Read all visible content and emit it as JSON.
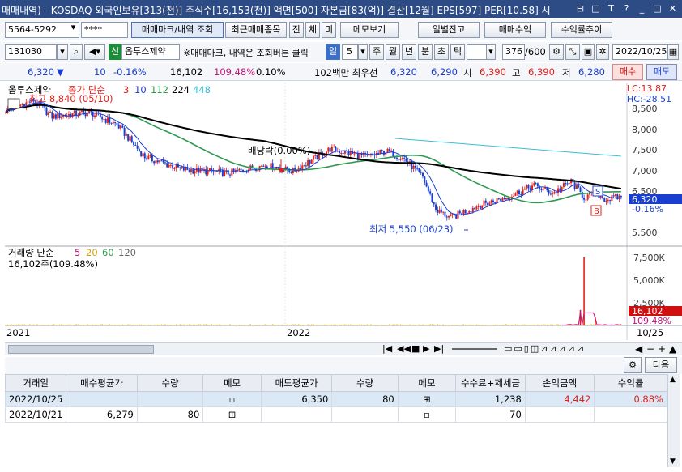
{
  "titlebar": {
    "text": "매매내역) - KOSDAQ 외국인보유[313(천)] 주식수[16,153(천)] 액면[500] 자본금[83(억)] 결산[12월] EPS[597] PER[10.58] 시"
  },
  "toolbar1": {
    "account": "5564-5292",
    "password": "****",
    "tab_trade": "매매마크/내역 조회",
    "tab_recent": "최근매매종목",
    "btn_jan": "잔",
    "btn_che": "체",
    "btn_mi": "미",
    "memo_view": "메모보기",
    "daily_balance": "일별잔고",
    "trade_profit": "매매수익",
    "return_trend": "수익률추이"
  },
  "toolbar2": {
    "code": "131030",
    "sin": "신",
    "stock_name": "옵투스제약",
    "notice": "※매매마크, 내역은 조회버튼 클릭",
    "period_active": "일",
    "period_value": "5",
    "periods": [
      "주",
      "월",
      "년",
      "분",
      "초",
      "틱"
    ],
    "count": "376",
    "count_total": "/600",
    "date": "2022/10/25"
  },
  "quote": {
    "price": "6,320",
    "arrow": "▼",
    "change": "10",
    "change_pct": "-0.16%",
    "volume": "16,102",
    "vol_ratio": "109.48%",
    "rate": "0.10%",
    "preferred": "102백만 최우선",
    "bid": "6,320",
    "ask": "6,290",
    "open_label": "시",
    "open": "6,390",
    "high_label": "고",
    "high": "6,390",
    "low_label": "저",
    "low": "6,280",
    "buy": "매수",
    "sell": "매도"
  },
  "chart": {
    "legend_name": "옵투스제약",
    "legend_ma": "종가 단순",
    "ma_values": [
      "3",
      "10",
      "112",
      "224",
      "448"
    ],
    "high_label": "최고 8,840 (05/10)",
    "low_label": "최저 5,550 (06/23)",
    "dividend_label": "배당락(0.00%)",
    "lc": "LC:13.87",
    "hc": "HC:-28.51",
    "price_axis": [
      "8,500",
      "8,000",
      "7,500",
      "7,000",
      "6,500",
      "5,500"
    ],
    "current_tag": "6,320",
    "current_pct": "-0.16%",
    "vol_legend": "거래량 단순",
    "vol_ma": [
      "5",
      "20",
      "60",
      "120"
    ],
    "vol_info": "16,102주(109.48%)",
    "vol_axis": [
      "7,500K",
      "5,000K",
      "2,500K"
    ],
    "vol_tag": "16,102",
    "vol_pct": "109.48%",
    "x_labels": [
      "2021",
      "2022"
    ],
    "x_end": "10/25",
    "colors": {
      "ma3": "#e0201b",
      "ma10": "#1a3fd0",
      "ma112": "#2e9a50",
      "ma224": "#000000",
      "ma448": "#36c0d8"
    }
  },
  "grid": {
    "next": "다음",
    "headers": [
      "거래일",
      "매수평균가",
      "수량",
      "메모",
      "매도평균가",
      "수량",
      "메모",
      "수수료+제세금",
      "손익금액",
      "수익률"
    ],
    "rows": [
      [
        "2022/10/25",
        "",
        "",
        "",
        "6,350",
        "80",
        "",
        "1,238",
        "4,442",
        "0.88%"
      ],
      [
        "2022/10/21",
        "6,279",
        "80",
        "",
        "",
        "",
        "",
        "70",
        "",
        ""
      ]
    ]
  }
}
